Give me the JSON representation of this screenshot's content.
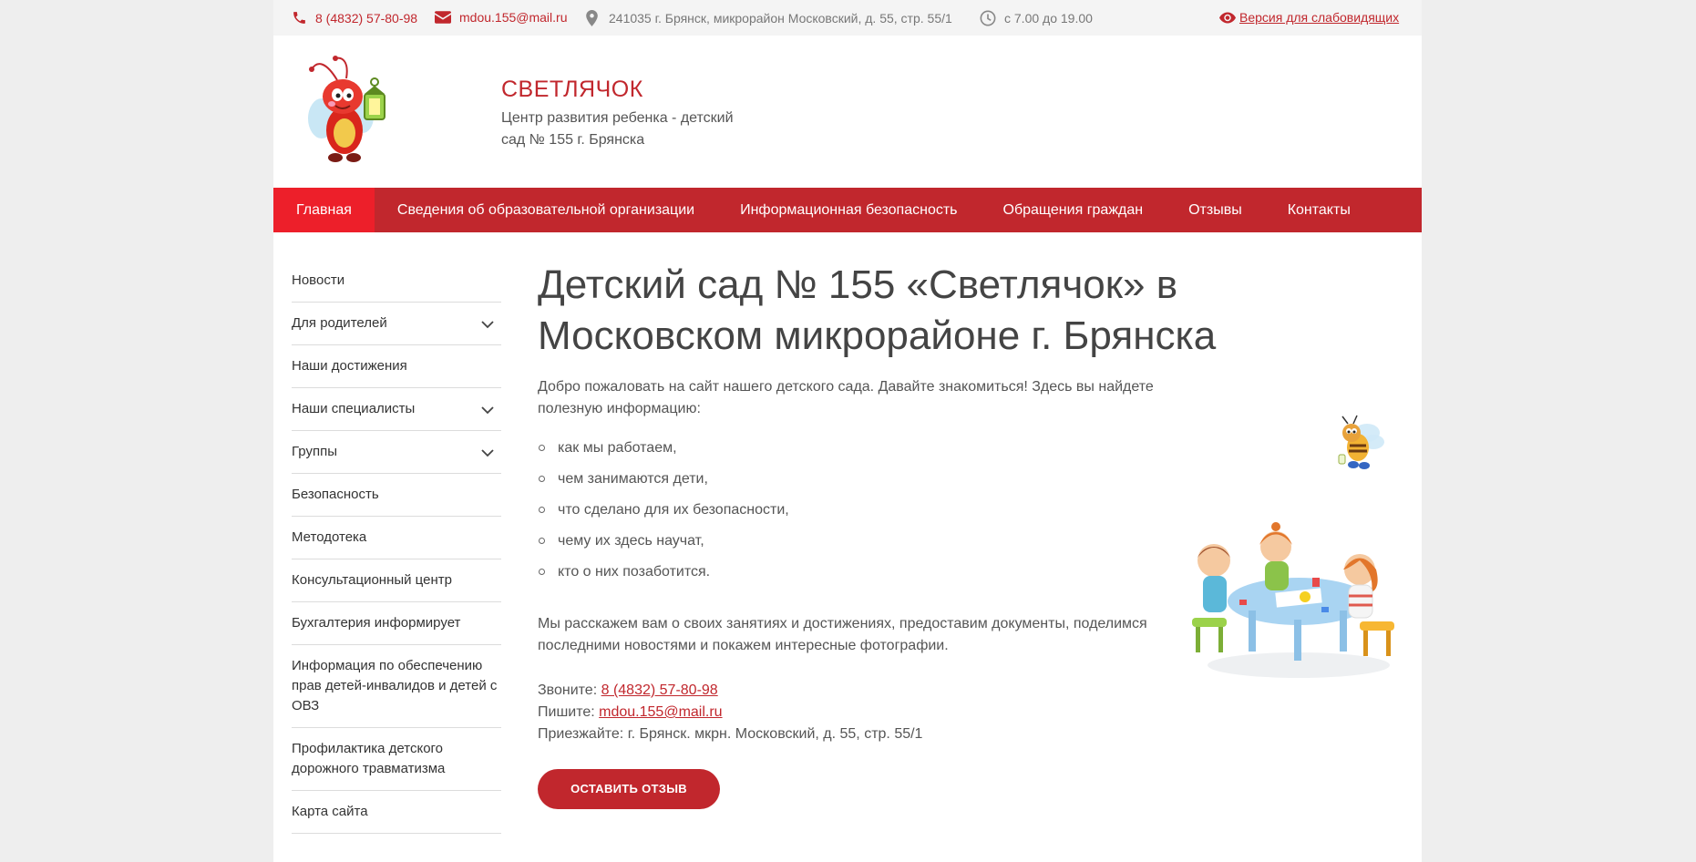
{
  "topbar": {
    "phone": "8 (4832) 57-80-98",
    "email": "mdou.155@mail.ru",
    "address": "241035 г. Брянск, микрорайон Московский, д. 55, стр. 55/1",
    "hours": "с 7.00 до 19.00",
    "vision_label": "Версия для слабовидящих",
    "icons": [
      "phone-icon",
      "envelope-icon",
      "map-marker-icon",
      "clock-icon",
      "eye-icon"
    ]
  },
  "header": {
    "title": "СВЕТЛЯЧОК",
    "subtitle": "Центр развития ребенка - детский сад № 155 г. Брянска"
  },
  "nav": {
    "items": [
      {
        "label": "Главная",
        "active": true
      },
      {
        "label": "Сведения об образовательной организации",
        "active": false
      },
      {
        "label": "Информационная безопасность",
        "active": false
      },
      {
        "label": "Обращения граждан",
        "active": false
      },
      {
        "label": "Отзывы",
        "active": false
      },
      {
        "label": "Контакты",
        "active": false
      }
    ]
  },
  "sidebar": {
    "items": [
      {
        "label": "Новости",
        "has_submenu": false
      },
      {
        "label": "Для родителей",
        "has_submenu": true
      },
      {
        "label": "Наши достижения",
        "has_submenu": false
      },
      {
        "label": "Наши специалисты",
        "has_submenu": true
      },
      {
        "label": "Группы",
        "has_submenu": true
      },
      {
        "label": "Безопасность",
        "has_submenu": false
      },
      {
        "label": "Методотека",
        "has_submenu": false
      },
      {
        "label": "Консультационный центр",
        "has_submenu": false
      },
      {
        "label": "Бухгалтерия информирует",
        "has_submenu": false
      },
      {
        "label": "Информация по обеспечению прав детей-инвалидов и детей с ОВЗ",
        "has_submenu": false
      },
      {
        "label": "Профилактика детского дорожного травматизма",
        "has_submenu": false
      },
      {
        "label": "Карта сайта",
        "has_submenu": false
      }
    ]
  },
  "main": {
    "heading": "Детский сад № 155 «Светлячок» в Московском микрорайоне г. Брянска",
    "intro": "Добро пожаловать на сайт нашего детского сада. Давайте знакомиться! Здесь вы найдете полезную информацию:",
    "list": [
      "как мы работаем,",
      "чем занимаются дети,",
      "что сделано для их безопасности,",
      "чему их здесь научат,",
      "кто о них позаботится."
    ],
    "outro": "Мы расскажем вам о своих занятиях и достижениях, предоставим документы, поделимся последними новостями и покажем интересные фотографии.",
    "call_label": "Звоните:",
    "call_value": "8 (4832) 57-80-98",
    "write_label": "Пишите:",
    "write_value": "mdou.155@mail.ru",
    "visit_label": "Приезжайте:",
    "visit_value": "г. Брянск. мкрн. Московский, д. 55, стр. 55/1",
    "button": "ОСТАВИТЬ ОТЗЫВ"
  },
  "colors": {
    "brand": "#c1272d",
    "nav_active": "#ed1f2a",
    "background": "#eeeeee"
  }
}
